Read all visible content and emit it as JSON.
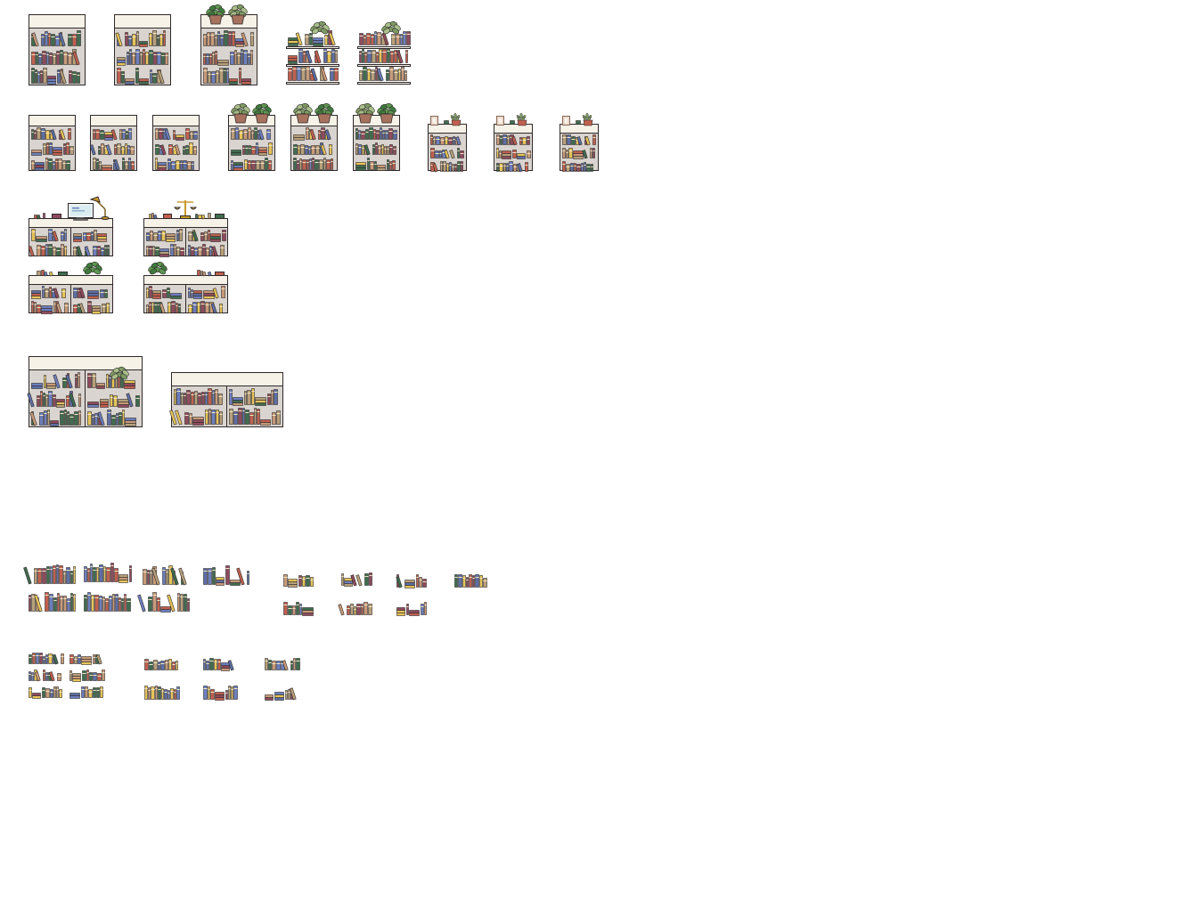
{
  "sheet": {
    "background": "#ffffff",
    "kind": "pixel-art furniture sprite sheet"
  },
  "palette": {
    "outline": "#2f2a2a",
    "wood_top": "#f7f2e8",
    "shelf_back": "#d9d4cf",
    "book_colors": [
      "#c0604f",
      "#6c7fbf",
      "#3f6d4f",
      "#e6c458",
      "#8f4b5d",
      "#b8a07a",
      "#5d6fa6",
      "#c89a78"
    ],
    "plant_dark": "#3f7a3f",
    "plant_light": "#a9bf8a",
    "pot": "#a6725e",
    "brass": "#c89a2b",
    "monitor_screen": "#d9ecf2"
  },
  "groups": [
    {
      "name": "tall-bookcases",
      "count": 5
    },
    {
      "name": "small-bookcases",
      "count": 9
    },
    {
      "name": "low-shelves-with-decor",
      "count": 4
    },
    {
      "name": "wide-bookcases",
      "count": 2
    },
    {
      "name": "book-rows",
      "count": 11
    },
    {
      "name": "book-piles",
      "count": 9
    }
  ],
  "decor_items": [
    "plant-icon",
    "monitor-icon",
    "desk-lamp-icon",
    "scales-icon",
    "photo-frame-icon",
    "mug-icon"
  ]
}
